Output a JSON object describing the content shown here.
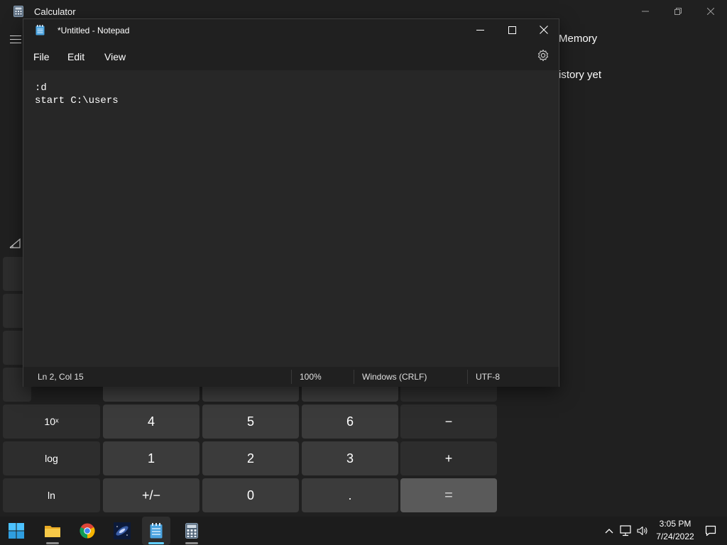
{
  "calculator": {
    "title": "Calculator",
    "memory_label": "Memory",
    "history_text": "istory yet",
    "keys": [
      {
        "label": "10ˣ",
        "kind": "fn"
      },
      {
        "label": "4",
        "kind": "num"
      },
      {
        "label": "5",
        "kind": "num"
      },
      {
        "label": "6",
        "kind": "num"
      },
      {
        "label": "−",
        "kind": "op"
      },
      {
        "label": "log",
        "kind": "fn"
      },
      {
        "label": "1",
        "kind": "num"
      },
      {
        "label": "2",
        "kind": "num"
      },
      {
        "label": "3",
        "kind": "num"
      },
      {
        "label": "+",
        "kind": "op"
      },
      {
        "label": "ln",
        "kind": "fn"
      },
      {
        "label": "+/−",
        "kind": "num"
      },
      {
        "label": "0",
        "kind": "num"
      },
      {
        "label": ".",
        "kind": "num"
      },
      {
        "label": "=",
        "kind": "eq"
      }
    ]
  },
  "notepad": {
    "title": "*Untitled - Notepad",
    "menu": {
      "file": "File",
      "edit": "Edit",
      "view": "View"
    },
    "content": {
      "line1": ":d",
      "line2": "start C:\\users"
    },
    "status": {
      "position": "Ln 2, Col 15",
      "zoom": "100%",
      "line_ending": "Windows (CRLF)",
      "encoding": "UTF-8"
    }
  },
  "taskbar": {
    "apps": [
      "start-icon",
      "file-explorer-icon",
      "chrome-icon",
      "photo-app-icon",
      "notepad-icon",
      "calculator-icon"
    ],
    "time": "3:05 PM",
    "date": "7/24/2022"
  },
  "colors": {
    "background": "#202020",
    "notepad_editor": "#272727",
    "number_key": "#3b3b3b",
    "function_key": "#2d2d2d",
    "equals_key": "#5a5a5a"
  }
}
